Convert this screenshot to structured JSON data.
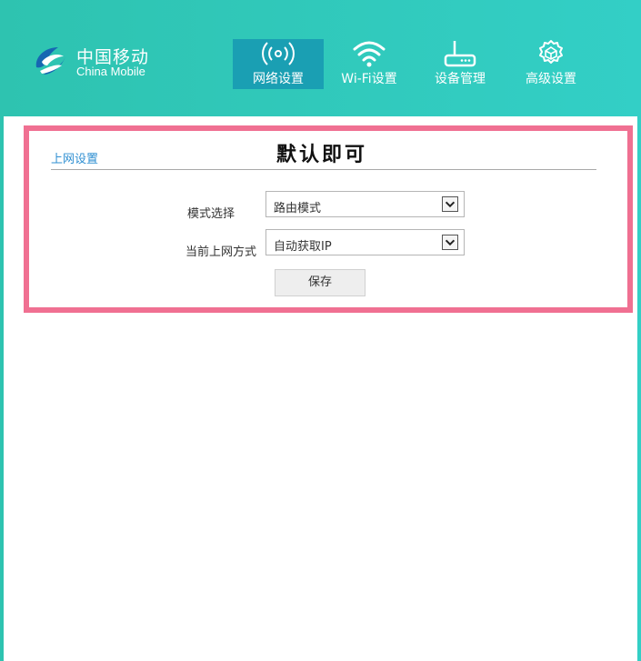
{
  "brand": {
    "name_cn": "中国移动",
    "name_en": "China Mobile",
    "color": "#ffffff"
  },
  "nav": {
    "items": [
      {
        "label": "网络设置",
        "icon": "wireless-signal-icon",
        "active": true
      },
      {
        "label": "Wi-Fi设置",
        "icon": "wifi-icon",
        "active": false
      },
      {
        "label": "设备管理",
        "icon": "router-icon",
        "active": false
      },
      {
        "label": "高级设置",
        "icon": "gear-icon",
        "active": false
      }
    ]
  },
  "panel": {
    "title": "上网设置",
    "annotation": "默认即可",
    "highlight_color": "#f07092"
  },
  "form": {
    "mode_label": "模式选择",
    "mode_value": "路由模式",
    "connection_label": "当前上网方式",
    "connection_value": "自动获取IP",
    "save_label": "保存"
  },
  "colors": {
    "header_start": "#2ec3b0",
    "header_end": "#33cfc6",
    "nav_active": "#1a9fb3",
    "link": "#2f8fd2"
  }
}
